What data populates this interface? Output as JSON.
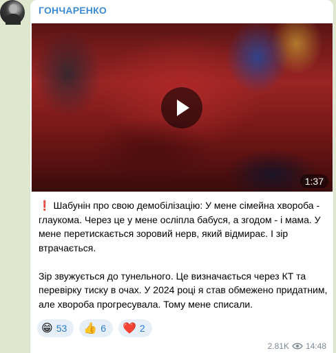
{
  "channel": {
    "name": "ГОНЧАРЕНКО"
  },
  "video": {
    "duration": "1:37"
  },
  "message": {
    "paragraphs": [
      "Шабунін про свою демобілізацію: У мене сімейна хвороба - глаукома. Через це у мене осліпла бабуся, а згодом - і мама. У мене перетискається зоровий нерв, який відмирає. І зір втрачається.",
      "Зір звужується до тунельного. Це визначається через КТ та перевірку тиску в очах. У 2024 році я став обмежено придатним, але хвороба прогресувала. Тому мене списали."
    ],
    "prefix_icon": "exclamation-icon"
  },
  "reactions": [
    {
      "emoji": "😁",
      "count": "53",
      "icon": "grin-icon"
    },
    {
      "emoji": "👍",
      "count": "6",
      "icon": "thumbs-up-icon"
    },
    {
      "emoji": "❤️",
      "count": "2",
      "icon": "heart-icon"
    }
  ],
  "footer": {
    "views": "2.81K",
    "time": "14:48"
  },
  "colors": {
    "sender": "#3d8bd5",
    "reaction_bg": "#e6eff8",
    "reaction_text": "#2a7bd0",
    "background": "#dfe7cf"
  }
}
